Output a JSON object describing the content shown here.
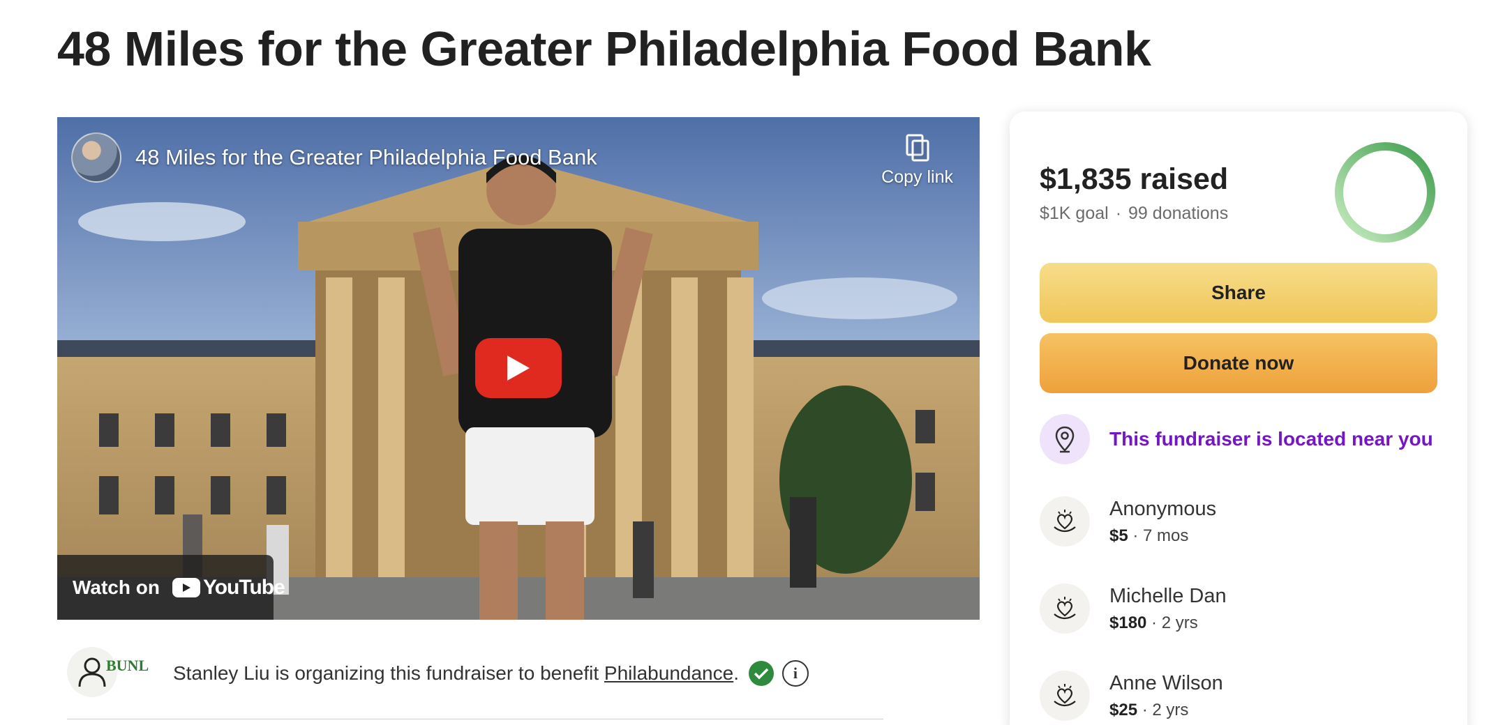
{
  "page": {
    "title": "48 Miles for the Greater Philadelphia Food Bank"
  },
  "video": {
    "title": "48 Miles for the Greater Philadelphia Food Bank",
    "copy_link_label": "Copy link",
    "watch_on_label": "Watch on",
    "youtube_label": "YouTube"
  },
  "organizer": {
    "logo_text": "BUNL",
    "text_prefix": "Stanley Liu is organizing this fundraiser to benefit ",
    "beneficiary": "Philabundance",
    "text_suffix": "."
  },
  "donation_card": {
    "raised_amount": "$1,835",
    "raised_word": "raised",
    "goal": "$1K goal",
    "separator": "·",
    "donations": "99 donations",
    "progress_fraction": 1.0,
    "share_label": "Share",
    "donate_label": "Donate now",
    "near_you_text": "This fundraiser is located near you",
    "colors": {
      "share": "#f2cf6e",
      "donate": "#f0b04a",
      "near_text": "#7317c6",
      "ring": "#5cb85c"
    },
    "donors": [
      {
        "name": "Anonymous",
        "amount": "$5",
        "time": "7 mos"
      },
      {
        "name": "Michelle Dan",
        "amount": "$180",
        "time": "2 yrs"
      },
      {
        "name": "Anne Wilson",
        "amount": "$25",
        "time": "2 yrs"
      }
    ]
  }
}
